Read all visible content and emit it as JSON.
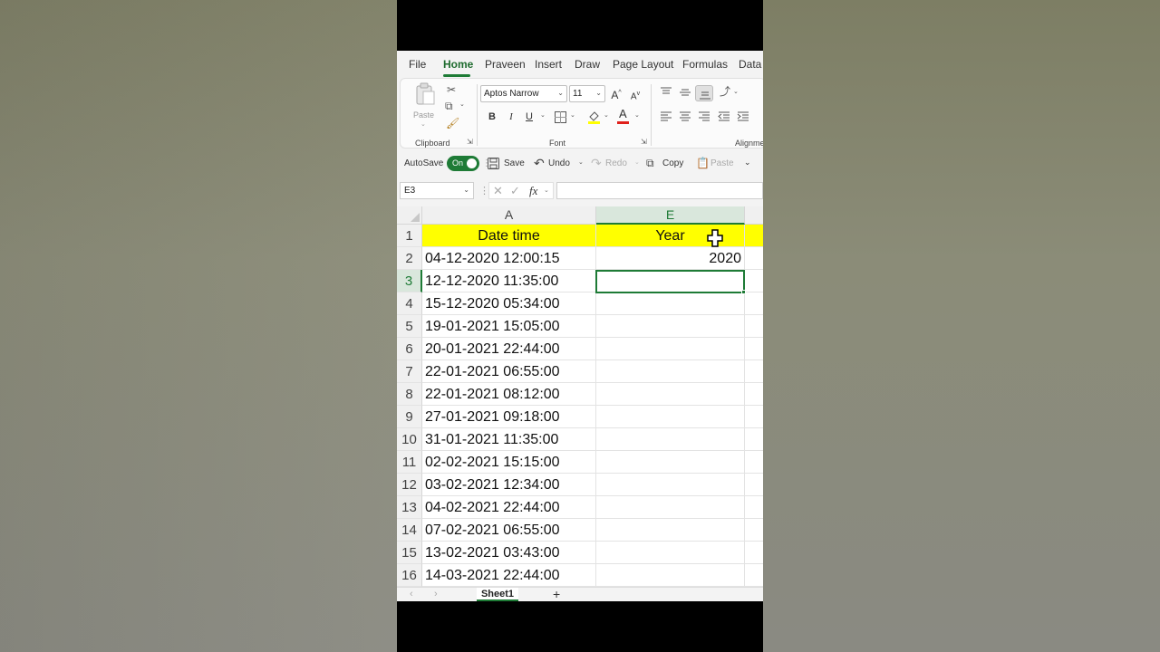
{
  "ribbon": {
    "tabs": [
      "File",
      "Home",
      "Praveen",
      "Insert",
      "Draw",
      "Page Layout",
      "Formulas",
      "Data"
    ],
    "active_tab": "Home",
    "clipboard": {
      "paste_label": "Paste",
      "group_label": "Clipboard"
    },
    "font": {
      "name": "Aptos Narrow",
      "size": "11",
      "bold": "B",
      "italic": "I",
      "underline": "U",
      "group_label": "Font"
    },
    "alignment": {
      "group_label": "Alignme"
    }
  },
  "qat": {
    "autosave_label": "AutoSave",
    "autosave_state": "On",
    "save_label": "Save",
    "undo_label": "Undo",
    "redo_label": "Redo",
    "copy_label": "Copy",
    "paste_label": "Paste"
  },
  "formula_bar": {
    "name_box": "E3",
    "fx_label": "fx",
    "formula": ""
  },
  "sheet": {
    "columns": [
      "A",
      "E"
    ],
    "selected_column": "E",
    "selected_row": "3",
    "selected_cell": "E3",
    "rows": [
      {
        "num": "1",
        "a": "Date time",
        "e": "Year",
        "header": true
      },
      {
        "num": "2",
        "a": "04-12-2020 12:00:15",
        "e": "2020"
      },
      {
        "num": "3",
        "a": "12-12-2020 11:35:00",
        "e": ""
      },
      {
        "num": "4",
        "a": "15-12-2020 05:34:00",
        "e": ""
      },
      {
        "num": "5",
        "a": "19-01-2021 15:05:00",
        "e": ""
      },
      {
        "num": "6",
        "a": "20-01-2021 22:44:00",
        "e": ""
      },
      {
        "num": "7",
        "a": "22-01-2021 06:55:00",
        "e": ""
      },
      {
        "num": "8",
        "a": "22-01-2021 08:12:00",
        "e": ""
      },
      {
        "num": "9",
        "a": "27-01-2021 09:18:00",
        "e": ""
      },
      {
        "num": "10",
        "a": "31-01-2021 11:35:00",
        "e": ""
      },
      {
        "num": "11",
        "a": "02-02-2021 15:15:00",
        "e": ""
      },
      {
        "num": "12",
        "a": "03-02-2021 12:34:00",
        "e": ""
      },
      {
        "num": "13",
        "a": "04-02-2021 22:44:00",
        "e": ""
      },
      {
        "num": "14",
        "a": "07-02-2021 06:55:00",
        "e": ""
      },
      {
        "num": "15",
        "a": "13-02-2021 03:43:00",
        "e": ""
      },
      {
        "num": "16",
        "a": "14-03-2021 22:44:00",
        "e": ""
      }
    ],
    "header_fill": "#ffff00",
    "accent": "#1e7b36"
  },
  "sheetbar": {
    "tab": "Sheet1",
    "add": "+"
  }
}
